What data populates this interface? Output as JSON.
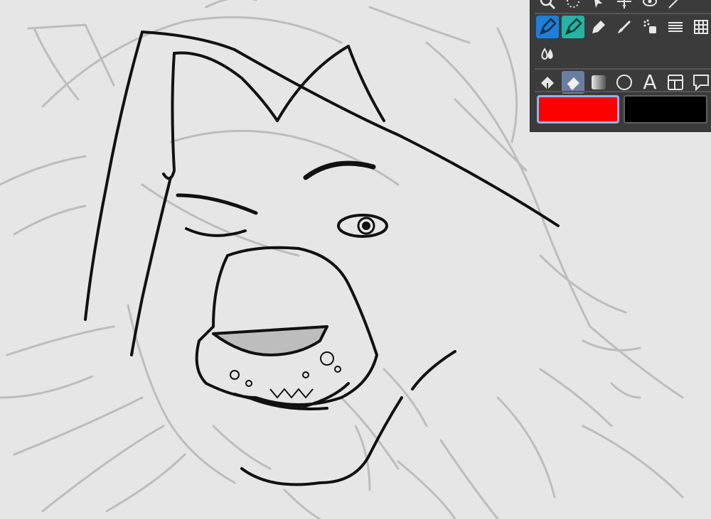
{
  "palette": {
    "tools_row_top": [
      "zoom-icon",
      "lasso-select-icon",
      "move-icon",
      "transform-icon",
      "eyedropper-icon",
      "ruler-icon"
    ],
    "tools_row_draw": [
      "pen-icon",
      "pen-alt-icon",
      "marker-icon",
      "brush-icon",
      "airbrush-icon",
      "hatch-icon",
      "grid-icon"
    ],
    "tools_row_blend": [
      "blend-icon"
    ],
    "tools_row_shapes": [
      "fill-bucket-icon",
      "eraser-icon",
      "gradient-icon",
      "ellipse-icon",
      "text-icon",
      "frame-icon",
      "balloon-icon"
    ],
    "text_tool_glyph": "A",
    "active_tools": [
      "pen-icon",
      "pen-alt-icon",
      "eraser-icon"
    ]
  },
  "colors": {
    "main_color": "#ff0000",
    "sub_color": "#000000",
    "palette_bg": "#3b3b3b",
    "canvas_bg": "#e6e6e6"
  }
}
